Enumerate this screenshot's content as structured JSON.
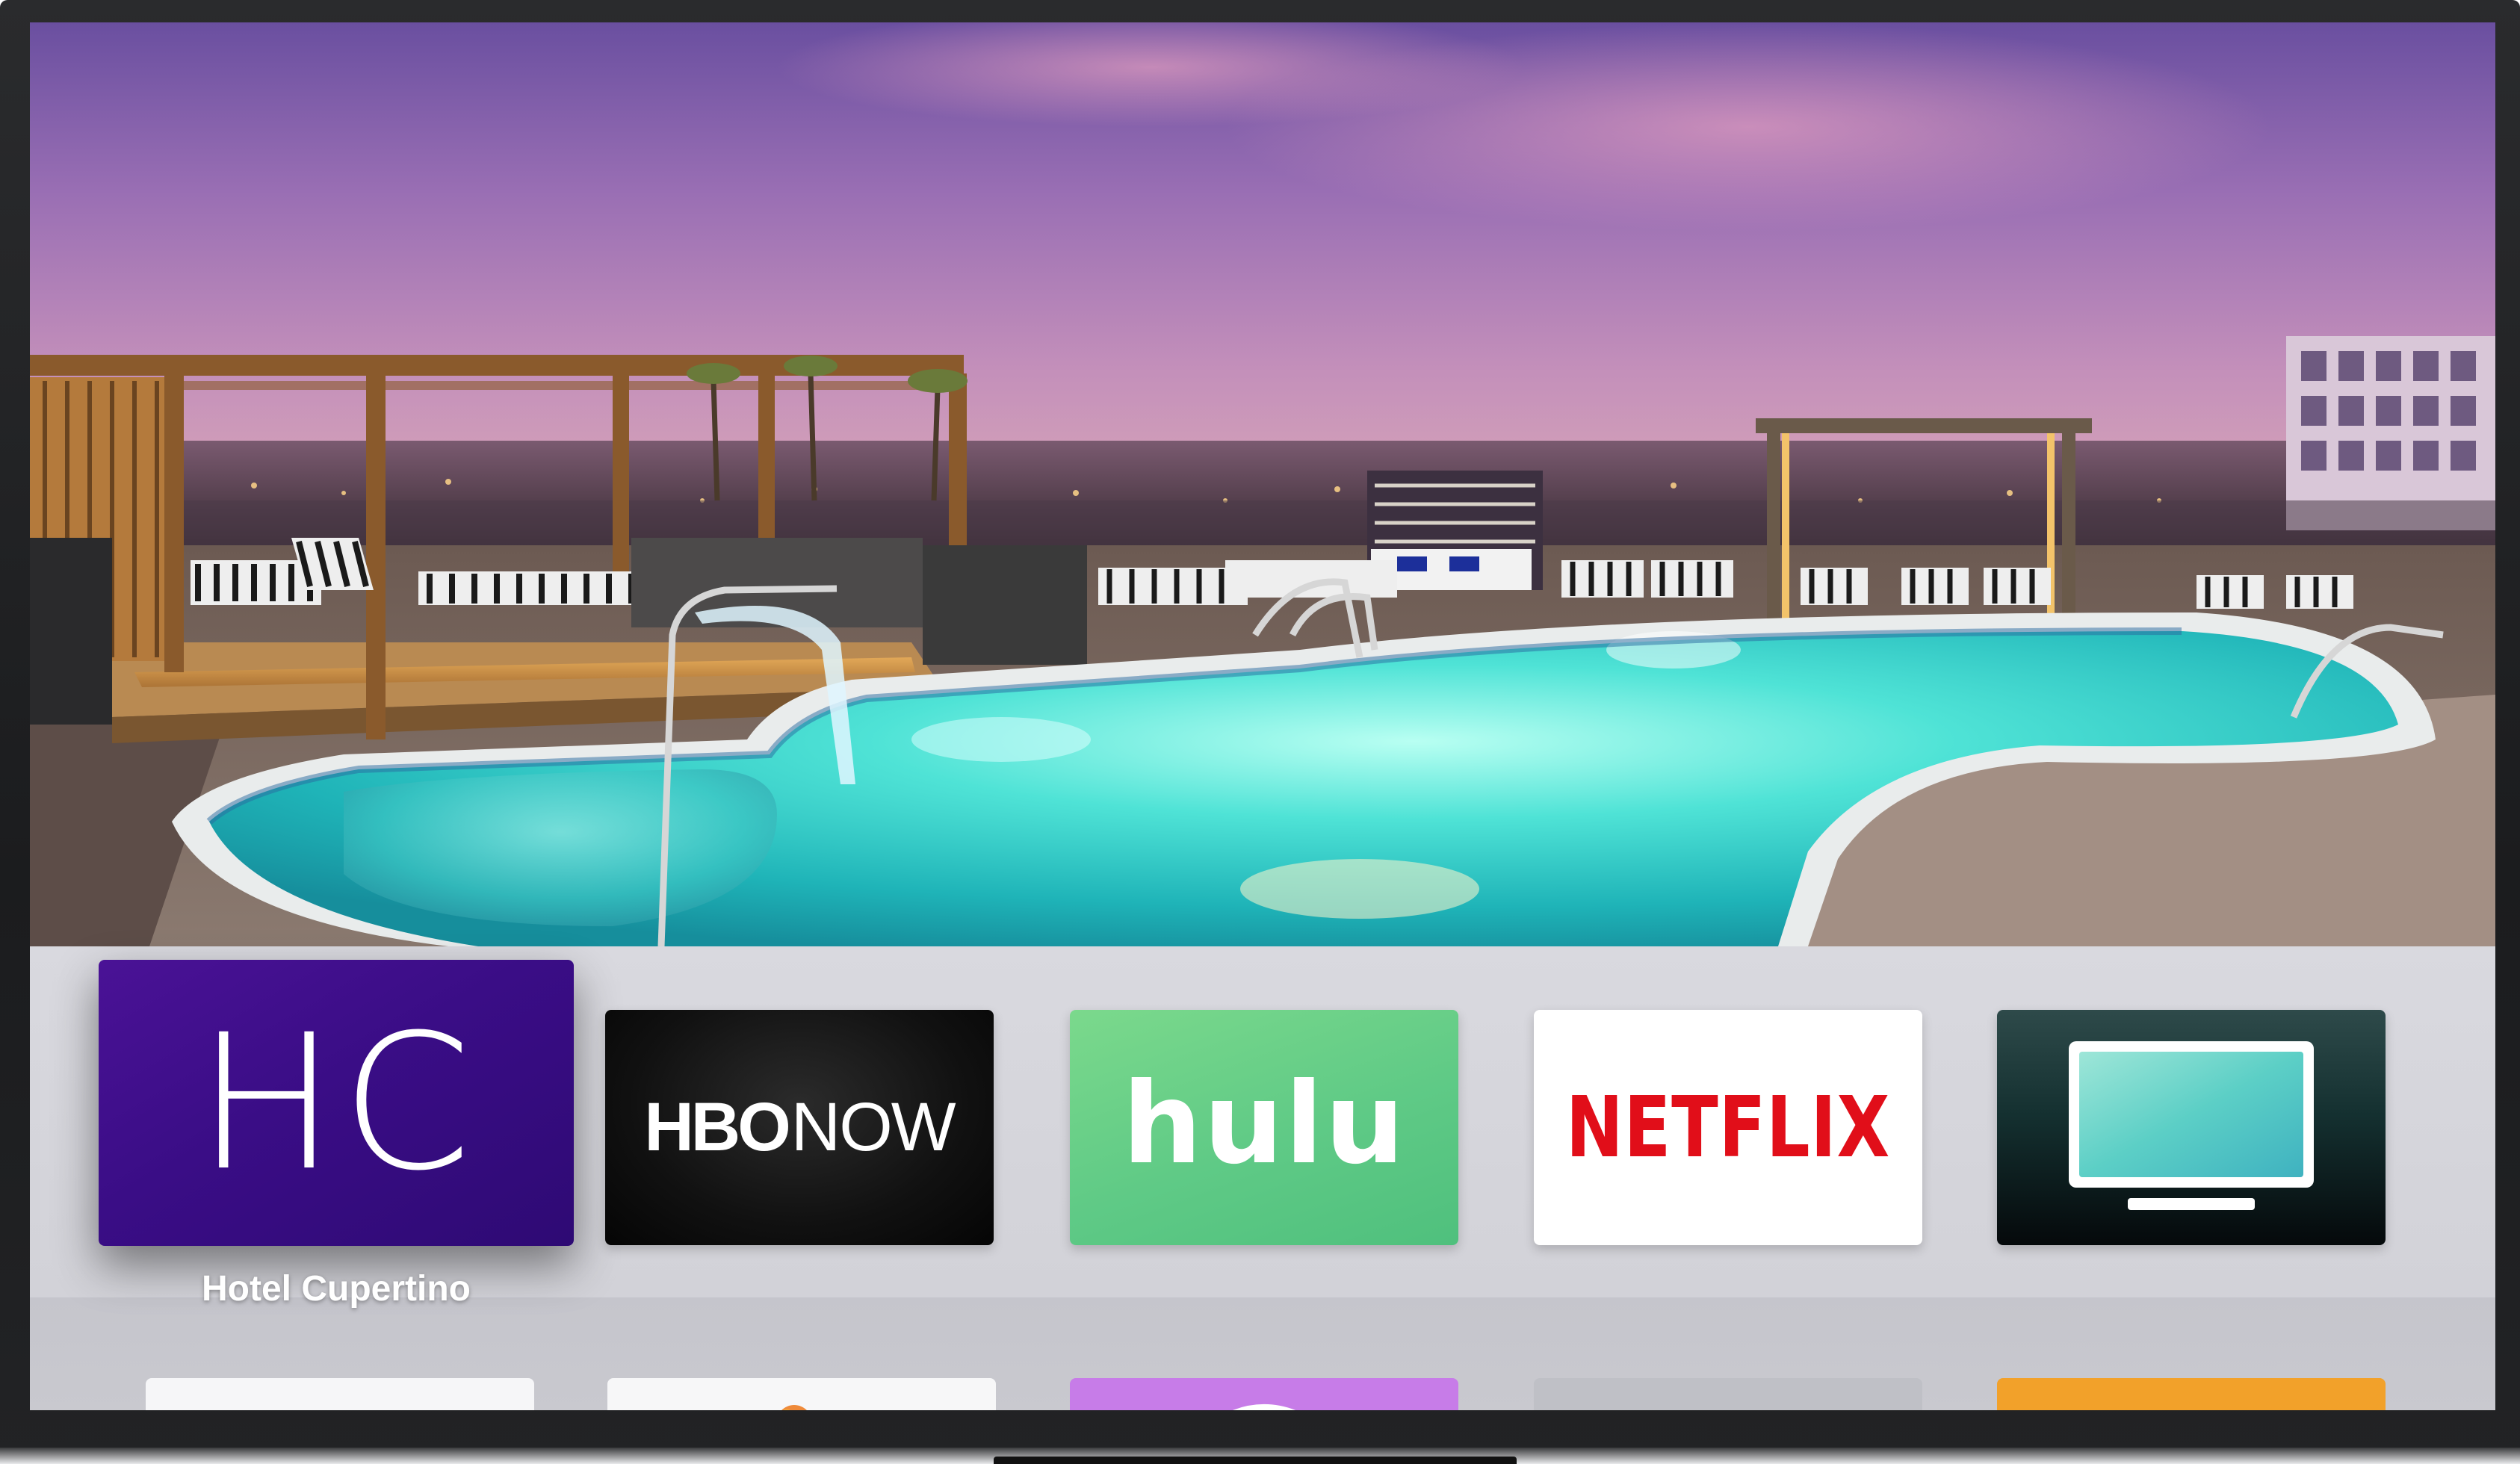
{
  "focused_app": {
    "name": "Hotel Cupertino",
    "icon_letters": "HC"
  },
  "top_shelf_apps": [
    {
      "id": "hotel-cupertino",
      "logo_text": "HC",
      "background": "#3a0d86"
    },
    {
      "id": "hbo-now",
      "logo_text_bold": "HBO",
      "logo_text_light": "NOW",
      "background": "#111111"
    },
    {
      "id": "hulu",
      "logo_text": "hulu",
      "background": "#5fca86"
    },
    {
      "id": "netflix",
      "logo_text": "NETFLIX",
      "background": "#ffffff",
      "accent": "#e10e19"
    },
    {
      "id": "tv",
      "icon": "tv-icon",
      "background": "#143030"
    }
  ],
  "second_row_apps": [
    {
      "icon": "photos-icon",
      "background": "#f6f6f8"
    },
    {
      "icon": "app-icon",
      "background": "#f7f7f8"
    },
    {
      "icon": "podcasts-icon",
      "background": "#c77ce8"
    },
    {
      "icon": "settings-icon",
      "background": "#bfc0c6"
    },
    {
      "icon": "app-icon",
      "background": "#f2a12a"
    }
  ]
}
